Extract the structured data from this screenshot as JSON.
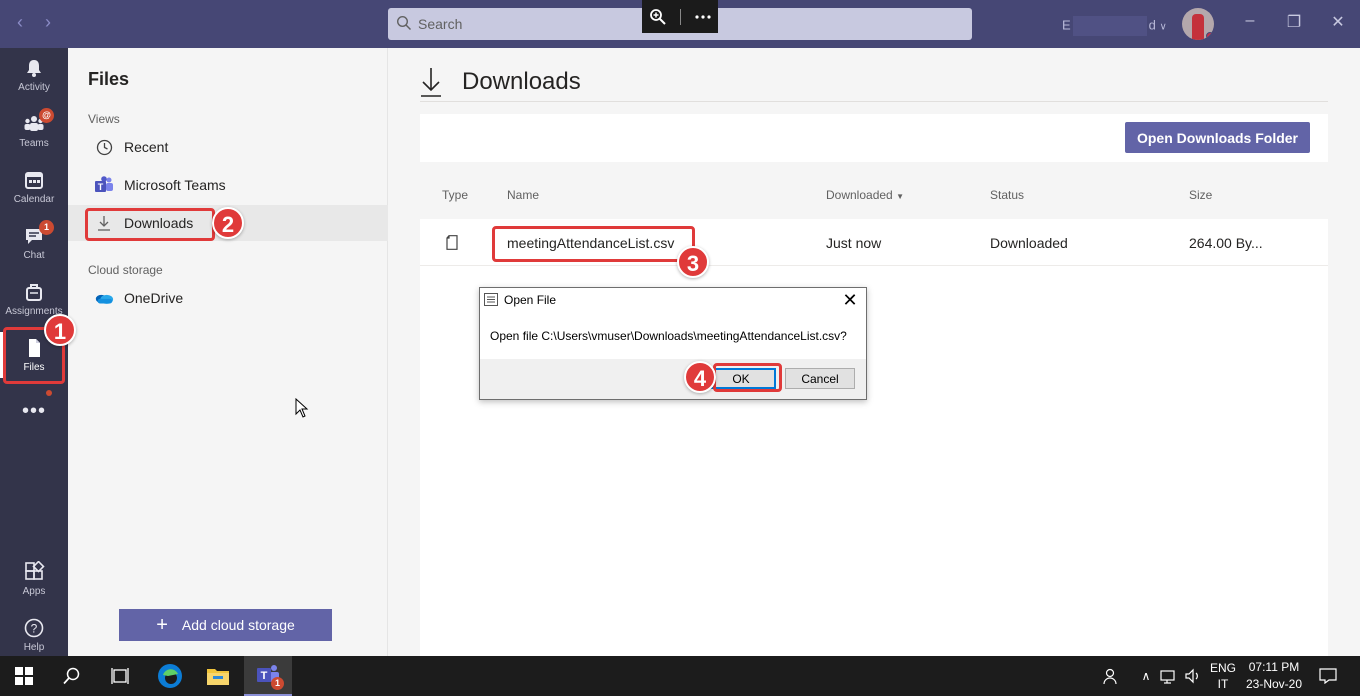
{
  "titlebar": {
    "search_placeholder": "Search",
    "profile_name_start": "E",
    "profile_name_end": "d"
  },
  "appbar": {
    "items": [
      {
        "label": "Activity",
        "icon": "bell-icon"
      },
      {
        "label": "Teams",
        "icon": "teams-icon",
        "badge": "@"
      },
      {
        "label": "Calendar",
        "icon": "calendar-icon"
      },
      {
        "label": "Chat",
        "icon": "chat-icon",
        "badge": "1"
      },
      {
        "label": "Assignments",
        "icon": "assignments-icon"
      },
      {
        "label": "Files",
        "icon": "file-icon",
        "active": true
      },
      {
        "label": "Apps",
        "icon": "apps-icon"
      },
      {
        "label": "Help",
        "icon": "help-icon"
      }
    ]
  },
  "leftpane": {
    "title": "Files",
    "views_label": "Views",
    "items": [
      {
        "label": "Recent",
        "icon": "clock-icon"
      },
      {
        "label": "Microsoft Teams",
        "icon": "teams-logo-icon"
      },
      {
        "label": "Downloads",
        "icon": "download-icon",
        "selected": true
      }
    ],
    "cloud_label": "Cloud storage",
    "cloud_items": [
      {
        "label": "OneDrive",
        "icon": "onedrive-icon"
      }
    ],
    "add_cloud_label": "Add cloud storage"
  },
  "main": {
    "title": "Downloads",
    "open_folder_label": "Open Downloads Folder",
    "columns": [
      "Type",
      "Name",
      "Downloaded",
      "Status",
      "Size"
    ],
    "rows": [
      {
        "name": "meetingAttendanceList.csv",
        "downloaded": "Just now",
        "status": "Downloaded",
        "size": "264.00 By..."
      }
    ]
  },
  "dialog": {
    "title": "Open File",
    "message": "Open file C:\\Users\\vmuser\\Downloads\\meetingAttendanceList.csv?",
    "ok_label": "OK",
    "cancel_label": "Cancel"
  },
  "annotations": {
    "steps": [
      "1",
      "2",
      "3",
      "4"
    ],
    "color": "#e03a3a"
  },
  "taskbar": {
    "lang": "ENG",
    "lang_sub": "IT",
    "time": "07:11 PM",
    "date": "23-Nov-20",
    "teams_badge": "1"
  },
  "colors": {
    "titlebar": "#464775",
    "appbar": "#33344a",
    "accent": "#6264a7"
  }
}
